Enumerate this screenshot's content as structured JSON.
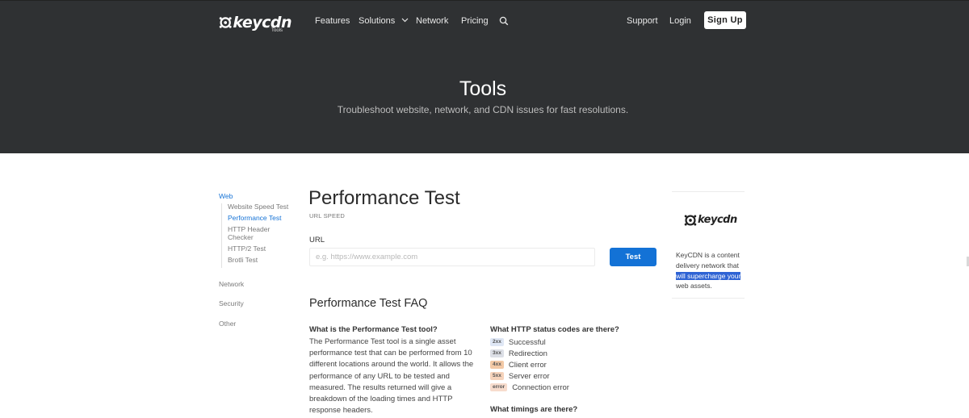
{
  "header": {
    "logo": {
      "brand": "keycdn",
      "sub": "Tools"
    },
    "nav": [
      {
        "label": "Features"
      },
      {
        "label": "Solutions"
      },
      {
        "label": "Network"
      },
      {
        "label": "Pricing"
      }
    ],
    "support_label": "Support",
    "login_label": "Login",
    "signup_label": "Sign Up"
  },
  "hero": {
    "title": "Tools",
    "subtitle": "Troubleshoot website, network, and CDN issues for fast resolutions."
  },
  "sidebar": {
    "categories": [
      {
        "label": "Web",
        "items": [
          {
            "label": "Website Speed Test"
          },
          {
            "label": "Performance Test"
          },
          {
            "label": "HTTP Header Checker"
          },
          {
            "label": "HTTP/2 Test"
          },
          {
            "label": "Brotli Test"
          }
        ]
      },
      {
        "label": "Network"
      },
      {
        "label": "Security"
      },
      {
        "label": "Other"
      }
    ]
  },
  "main": {
    "title": "Performance Test",
    "eyebrow": "URL SPEED",
    "url_label": "URL",
    "url_placeholder": "e.g. https://www.example.com",
    "url_value": "",
    "test_label": "Test",
    "faq_title": "Performance Test FAQ",
    "q1": {
      "question": "What is the Performance Test tool?",
      "answer": "The Performance Test tool is a single asset performance test that can be performed from 10 different locations around the world. It allows the performance of any URL to be tested and measured. The results returned will give a breakdown of the loading times and HTTP response headers."
    },
    "q2": {
      "question": "What HTTP status codes are there?",
      "codes": [
        {
          "code": "2xx",
          "label": "Successful",
          "color": "#dfe7f5"
        },
        {
          "code": "3xx",
          "label": "Redirection",
          "color": "#dcdfe6"
        },
        {
          "code": "4xx",
          "label": "Client error",
          "color": "#f3c9a6"
        },
        {
          "code": "5xx",
          "label": "Server error",
          "color": "#f6d3bb"
        },
        {
          "code": "error",
          "label": "Connection error",
          "color": "#f7dccd"
        }
      ]
    },
    "q3": {
      "question": "What timings are there?"
    }
  },
  "ad": {
    "brand": "keycdn",
    "text_before": "KeyCDN is a content delivery network that ",
    "text_highlight": "will supercharge your",
    "text_after": " web assets."
  },
  "colors": {
    "hero_bg": "#2f3133",
    "accent": "#1372d6",
    "active_link": "#1673d6",
    "highlight": "#2e63d4"
  }
}
